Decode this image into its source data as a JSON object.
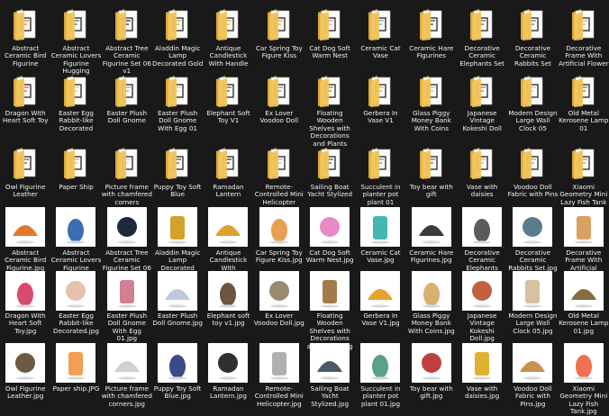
{
  "colors": {
    "background": "#191919",
    "text": "#f2f2f2",
    "folder": "#f0c356",
    "folder_dark": "#d9a73a",
    "tile": "#ffffff"
  },
  "folders_row1": [
    "Abstract Ceramic Bird Figurine",
    "Abstract Ceramic Lovers Figurine Hugging",
    "Abstract Tree Ceramic Figurine Set 06 v1",
    "Aladdin Magic Lamp Decorated Gold",
    "Antique Candlestick With Handle",
    "Car Spring Toy Figure Kiss",
    "Cat Dog Soft Warm Nest",
    "Ceramic Cat Vase",
    "Ceramic Hare Figurines",
    "Decorative Ceramic Elephants Set",
    "Decorative Ceramic Rabbits Set",
    "Decorative Frame With Artificial Flower"
  ],
  "folders_row2": [
    "Dragon With Heart Soft Toy",
    "Easter Egg Rabbit-like Decorated",
    "Easter Plush Doll Gnome",
    "Easter Plush Doll Gnome With Egg 01",
    "Elephant Soft Toy V1",
    "Ex Lover Voodoo Doll",
    "Floating Wooden Shelves with Decorations and Plants",
    "Gerbera In Vase V1",
    "Glass Piggy Money Bank With Coins",
    "Japanese Vintage Kokeshi Doll",
    "Modern Design Large Wall Clock 05",
    "Old Metal Kerosene Lamp 01"
  ],
  "folders_row3": [
    "Owl Figurine Leather",
    "Paper Ship",
    "Picture frame with chamfered corners",
    "Puppy Toy Soft Blue",
    "Ramadan Lantern",
    "Remote-Controlled Mini Helicopter",
    "Sailing Boat Yacht Stylized",
    "Succulent in planter pot plant 01",
    "Toy bear with gift",
    "Vase with daisies",
    "Voodoo Doll Fabric with Pins",
    "Xiaomi Geometry Mini Lazy Fish Tank"
  ],
  "files_row1": [
    "Abstract Ceramic Bird Figurine.jpg",
    "Abstract Ceramic Lovers Figurine Hugging.jpg",
    "Abstract Tree Ceramic Figurine Set 06 v1.jpg",
    "Aladdin Magic Lamp Decorated Gold.jpg",
    "Antique Candlestick With Handle.jpg",
    "Car Spring Toy Figure Kiss.jpg",
    "Cat Dog Soft Warm Nest.jpg",
    "Ceramic Cat Vase.jpg",
    "Ceramic Hare Figurines.jpg",
    "Decorative Ceramic Elephants Set.jpg",
    "Decorative Ceramic Rabbits Set.jpg",
    "Decorative Frame With Artificial Flower.jpg"
  ],
  "files_row2": [
    "Dragon With Heart Soft Toy.jpg",
    "Easter Egg Rabbit-like Decorated.jpg",
    "Easter Plush Doll Gnome With Egg 01.jpg",
    "Easter Plush Doll Gnome.jpg",
    "Elephant soft toy v1.jpg",
    "Ex Lover Voodoo Doll.jpg",
    "Floating Wooden Shelves with Decorations and Plants.jpg",
    "Gerbera In Vase V1.jpg",
    "Glass Piggy Money Bank With Coins.jpg",
    "Japanese Vintage Kokeshi Doll.jpg",
    "Modern Design Large Wall Clock 05.jpg",
    "Old Metal Kerosene Lamp 01.jpg"
  ],
  "files_row3": [
    "Owl Figurine Leather.jpg",
    "Paper ship.JPG",
    "Picture frame with chamfered corners.jpg",
    "Puppy Toy Soft Blue.jpg",
    "Ramadan Lantern.jpg",
    "Remote-Controlled Mini Helicopter.jpg",
    "Sailing Boat Yacht Stylized.jpg",
    "Succulent in planter pot plant 01.jpg",
    "Toy bear with gift.jpg",
    "Vase with daisies.jpg",
    "Voodoo Doll Fabric with Pins.jpg",
    "Xiaomi Geometry Mini Lazy Fish Tank.jpg"
  ],
  "thumb_accents_row1": [
    "#e07a2a",
    "#3a6fb0",
    "#1c2a3a",
    "#d4a12a",
    "#e0a030",
    "#e8a050",
    "#e58cc4",
    "#44b7b0",
    "#3b3b3b",
    "#5b5b5b",
    "#5a7d8c",
    "#d9a060"
  ],
  "thumb_accents_row2": [
    "#d94b6e",
    "#e8c0b0",
    "#d08090",
    "#c0c8e0",
    "#6b5544",
    "#9a8a70",
    "#a47a4c",
    "#e8a030",
    "#d8b070",
    "#c06040",
    "#d8c0a0",
    "#8a6a40"
  ],
  "thumb_accents_row3": [
    "#6e5a44",
    "#f0a050",
    "#d0d0d0",
    "#3a4a8a",
    "#303030",
    "#b0b0b0",
    "#4a5a6a",
    "#5aa08a",
    "#c04040",
    "#e0b030",
    "#c89050",
    "#f07050"
  ]
}
